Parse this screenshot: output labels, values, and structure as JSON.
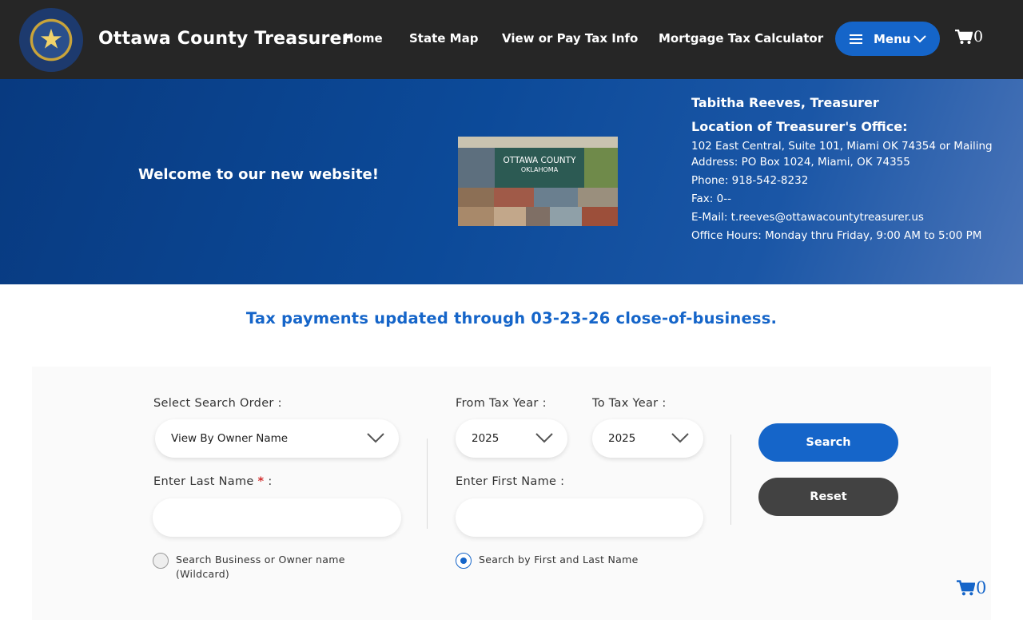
{
  "header": {
    "title": "Ottawa County Treasurer",
    "nav": [
      "Home",
      "State Map",
      "View or Pay Tax Info",
      "Mortgage Tax Calculator"
    ],
    "menu_label": "Menu",
    "cart_count": "0"
  },
  "banner": {
    "welcome": "Welcome to our new website!",
    "collage_title": "OTTAWA COUNTY",
    "collage_subtitle": "OKLAHOMA",
    "treasurer": "Tabitha Reeves, Treasurer",
    "location_heading": "Location of Treasurer's Office:",
    "address": "102 East Central, Suite 101, Miami OK 74354 or Mailing Address: PO Box 1024, Miami, OK 74355",
    "phone": "Phone: 918-542-8232",
    "fax": "Fax: 0--",
    "email": "E-Mail: t.reeves@ottawacountytreasurer.us",
    "hours": "Office Hours: Monday thru Friday, 9:00 AM to 5:00 PM"
  },
  "status": "Tax payments updated through 03-23-26 close-of-business.",
  "search": {
    "order_label": "Select Search Order :",
    "order_value": "View By Owner Name",
    "from_label": "From Tax Year :",
    "from_value": "2025",
    "to_label": "To Tax Year :",
    "to_value": "2025",
    "last_name_label": "Enter Last Name",
    "required_mark": "*",
    "label_colon": ":",
    "last_name_value": "",
    "first_name_label": "Enter First Name :",
    "first_name_value": "",
    "search_button": "Search",
    "reset_button": "Reset",
    "radio_wildcard": "Search Business or Owner name (Wildcard)",
    "radio_first_last": "Search by First and Last Name",
    "radio_selected": "first_last"
  },
  "floating_cart_count": "0",
  "colors": {
    "header_bg": "#262626",
    "accent": "#1565c9",
    "banner_start": "#083a80",
    "banner_end": "#4a74b8",
    "reset_bg": "#424242",
    "required": "#d32f2f"
  },
  "icons": {
    "seal": "state-seal-icon",
    "menu": "hamburger-icon",
    "chevron": "chevron-down-icon",
    "cart": "shopping-cart-icon"
  }
}
